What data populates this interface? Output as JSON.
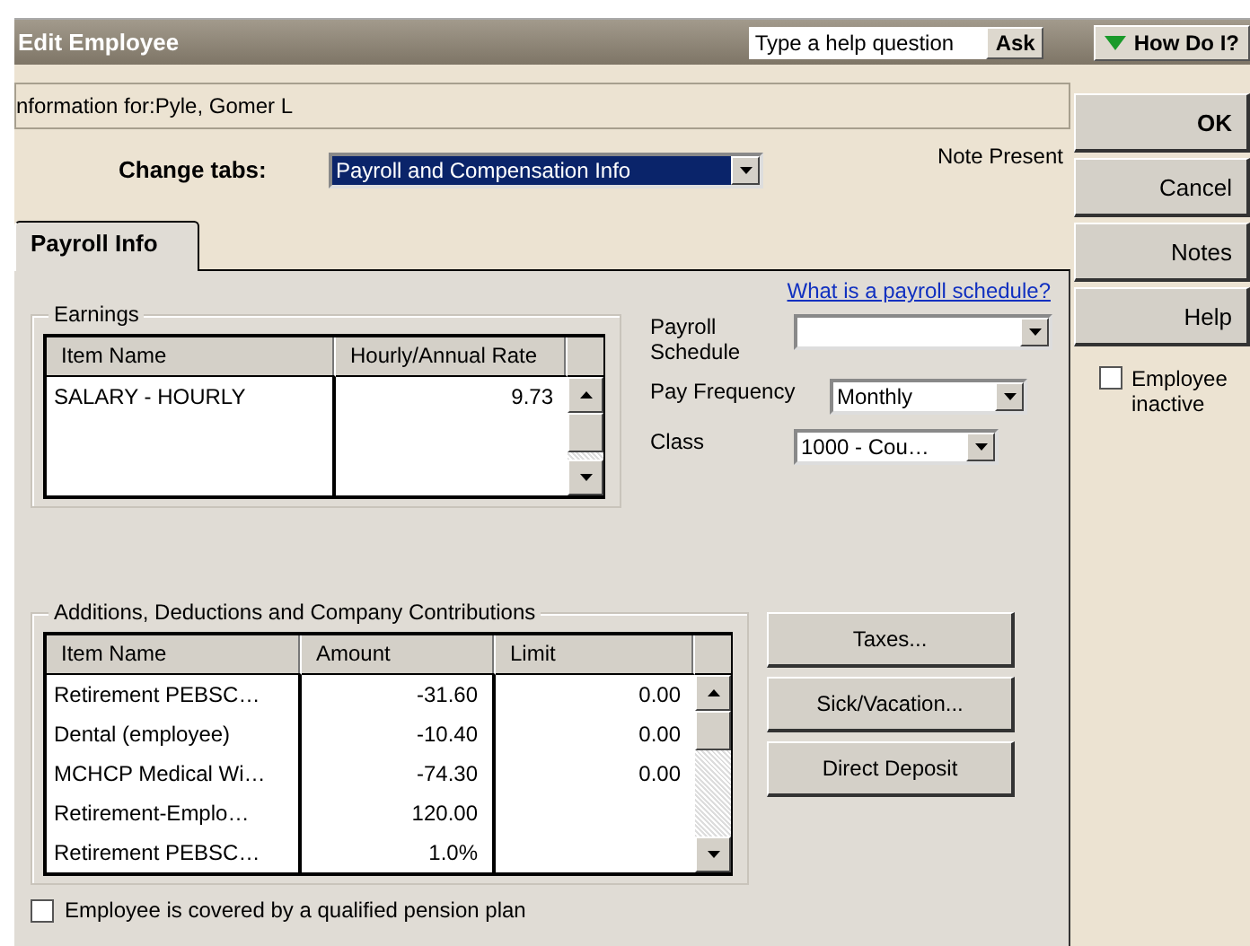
{
  "window": {
    "title": "Edit Employee"
  },
  "help": {
    "placeholder": "Type a help question",
    "ask": "Ask",
    "how_do_i": "How Do I?"
  },
  "info_for": "nformation for:Pyle, Gomer L",
  "change_tabs": {
    "label": "Change tabs:",
    "value": "Payroll and Compensation Info"
  },
  "note_status": "Note Present",
  "tabs": [
    {
      "label": "Payroll Info",
      "selected": true
    }
  ],
  "earnings": {
    "title": "Earnings",
    "columns": [
      "Item Name",
      "Hourly/Annual Rate"
    ],
    "rows": [
      [
        "SALARY - HOURLY",
        "9.73"
      ]
    ]
  },
  "schedule_link": "What is a payroll schedule?",
  "fields": [
    {
      "label": "Payroll Schedule"
    },
    {
      "label": "Pay Frequency",
      "value": "Monthly"
    },
    {
      "label": "Class",
      "value": "1000 - Cou…"
    }
  ],
  "deductions": {
    "title": "Additions, Deductions and Company Contributions",
    "columns": [
      "Item Name",
      "Amount",
      "Limit"
    ],
    "rows": [
      [
        "Retirement PEBSC…",
        "-31.60",
        "0.00"
      ],
      [
        "Dental (employee)",
        "-10.40",
        "0.00"
      ],
      [
        "MCHCP Medical Wi…",
        "-74.30",
        "0.00"
      ],
      [
        "Retirement-Emplo…",
        "120.00"
      ],
      [
        "Retirement PEBSC…",
        "1.0%"
      ]
    ]
  },
  "side_buttons": [
    "Taxes...",
    "Sick/Vacation...",
    "Direct Deposit"
  ],
  "pension": {
    "label": "Employee is covered by a qualified pension plan",
    "checked": false
  },
  "actions": [
    {
      "label": "OK",
      "default": true
    },
    {
      "label": "Cancel",
      "default": false
    },
    {
      "label": "Notes",
      "default": false
    },
    {
      "label": "Help",
      "default": false
    }
  ],
  "inactive": {
    "label": "Employee inactive",
    "checked": false
  }
}
